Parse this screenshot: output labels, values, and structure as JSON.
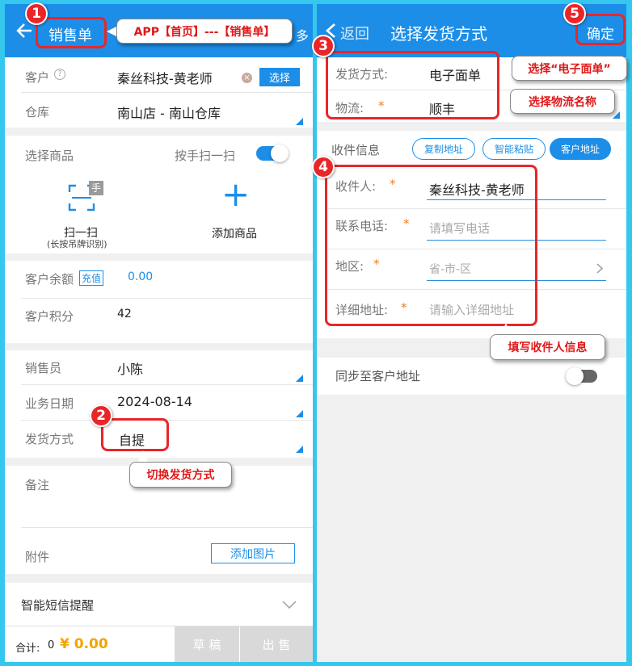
{
  "left": {
    "header": {
      "title": "销售单",
      "more": "多"
    },
    "customer": {
      "label": "客户",
      "value": "秦丝科技-黄老师",
      "select_btn": "选择"
    },
    "warehouse": {
      "label": "仓库",
      "value": "南山店 - 南山仓库"
    },
    "products": {
      "title": "选择商品",
      "hand_scan_label": "按手扫一扫",
      "scan_label": "扫一扫",
      "scan_sub": "(长按吊牌识别)",
      "scan_badge": "手",
      "add_label": "添加商品",
      "add_glyph": "+"
    },
    "balance": {
      "label": "客户余额",
      "recharge": "充值",
      "value": "0.00"
    },
    "points": {
      "label": "客户积分",
      "value": "42"
    },
    "salesperson": {
      "label": "销售员",
      "value": "小陈"
    },
    "biz_date": {
      "label": "业务日期",
      "value": "2024-08-14"
    },
    "delivery": {
      "label": "发货方式",
      "value": "自提"
    },
    "remark": {
      "label": "备注"
    },
    "attachment": {
      "label": "附件",
      "add_image": "添加图片"
    },
    "sms": {
      "label": "智能短信提醒"
    },
    "footer": {
      "total_label": "合计:",
      "total_qty": "0",
      "total_amount": "¥ 0.00",
      "draft": "草 稿",
      "sell": "出 售"
    }
  },
  "right": {
    "header": {
      "back": "返回",
      "title": "选择发货方式",
      "confirm": "确定"
    },
    "method": {
      "label": "发货方式:",
      "value": "电子面单"
    },
    "logistics": {
      "label": "物流:",
      "star": "*",
      "value": "顺丰"
    },
    "receiver_info": {
      "title": "收件信息",
      "copy_addr": "复制地址",
      "smart_paste": "智能粘贴",
      "customer_addr": "客户地址"
    },
    "receiver": {
      "label": "收件人:",
      "star": "*",
      "value": "秦丝科技-黄老师"
    },
    "phone": {
      "label": "联系电话:",
      "star": "*",
      "placeholder": "请填写电话"
    },
    "region": {
      "label": "地区:",
      "star": "*",
      "placeholder": "省-市-区"
    },
    "address": {
      "label": "详细地址:",
      "star": "*",
      "placeholder": "请输入详细地址"
    },
    "sync": {
      "label": "同步至客户地址"
    }
  },
  "annotations": {
    "n1": "1",
    "n2": "2",
    "n3": "3",
    "n4": "4",
    "n5": "5",
    "c1": "APP【首页】---【销售单】",
    "c2": "切换发货方式",
    "c3": "选择“电子面单”",
    "c4": "选择物流名称",
    "c5": "填写收件人信息"
  },
  "colors": {
    "primary": "#1c8ee8",
    "annotation_red": "#e8262a",
    "amount_orange": "#f5a200",
    "frame": "#35c7ee"
  }
}
